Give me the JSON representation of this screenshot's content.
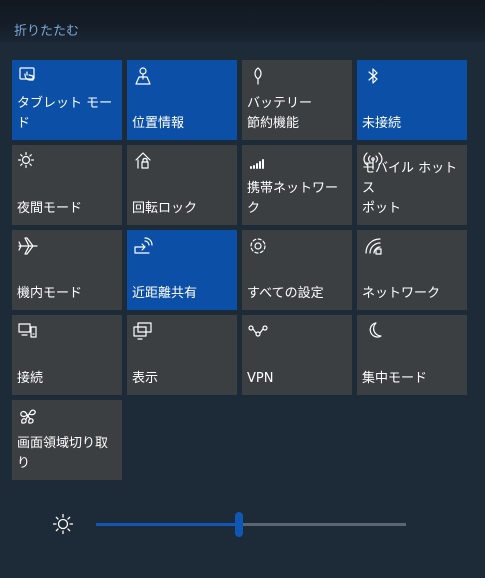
{
  "collapse_label": "折りたたむ",
  "tiles": [
    {
      "label": "タブレット モード",
      "icon": "tablet-mode-icon",
      "active": true
    },
    {
      "label": "位置情報",
      "icon": "location-icon",
      "active": true
    },
    {
      "label": "バッテリー\n節約機能",
      "icon": "battery-saver-icon",
      "active": false
    },
    {
      "label": "未接続",
      "icon": "bluetooth-icon",
      "active": true
    },
    {
      "label": "夜間モード",
      "icon": "night-light-icon",
      "active": false
    },
    {
      "label": "回転ロック",
      "icon": "rotation-lock-icon",
      "active": false
    },
    {
      "label": "携帯ネットワーク",
      "icon": "cellular-icon",
      "active": false
    },
    {
      "label": "モバイル ホットス\nポット",
      "icon": "mobile-hotspot-icon",
      "active": false
    },
    {
      "label": "機内モード",
      "icon": "airplane-icon",
      "active": false
    },
    {
      "label": "近距離共有",
      "icon": "nearby-share-icon",
      "active": true
    },
    {
      "label": "すべての設定",
      "icon": "gear-icon",
      "active": false
    },
    {
      "label": "ネットワーク",
      "icon": "network-icon",
      "active": false
    },
    {
      "label": "接続",
      "icon": "connect-icon",
      "active": false
    },
    {
      "label": "表示",
      "icon": "project-icon",
      "active": false
    },
    {
      "label": "VPN",
      "icon": "vpn-icon",
      "active": false
    },
    {
      "label": "集中モード",
      "icon": "moon-icon",
      "active": false
    },
    {
      "label": "画面領域切り取\nり",
      "icon": "snip-icon",
      "active": false
    }
  ],
  "brightness": {
    "icon": "brightness-icon",
    "level_fraction": 0.46
  },
  "colors": {
    "background": "#1d2a38",
    "tile": "#3c3f42",
    "tile_active": "#0b4fa6",
    "accent": "#0f57b4",
    "link": "#7aa6d6"
  }
}
